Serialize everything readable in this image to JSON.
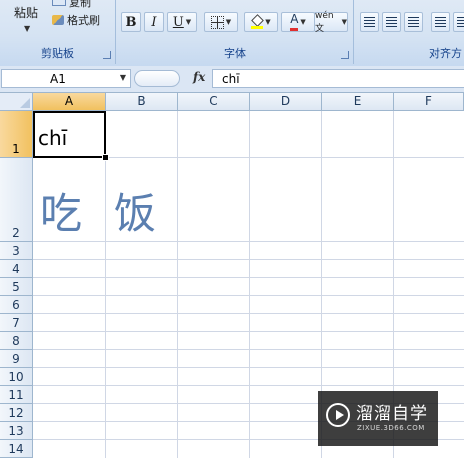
{
  "ribbon": {
    "clipboard": {
      "paste_label": "粘贴",
      "copy_label": "复制",
      "format_painter_label": "格式刷",
      "group_label": "剪贴板"
    },
    "font": {
      "bold": "B",
      "italic": "I",
      "underline": "U",
      "fill_color": "#ffff00",
      "font_color": "#e03030",
      "phonetic_label": "wén 文",
      "group_label": "字体"
    },
    "alignment": {
      "group_label": "对齐方"
    }
  },
  "formula_bar": {
    "name_box": "A1",
    "fx_label": "fx",
    "content": "chī"
  },
  "columns": [
    "A",
    "B",
    "C",
    "D",
    "E",
    "F"
  ],
  "rows": [
    "1",
    "2",
    "3",
    "4",
    "5",
    "6",
    "7",
    "8",
    "9",
    "10",
    "11",
    "12",
    "13",
    "14"
  ],
  "cells": {
    "A1": "chī",
    "A2": "吃",
    "B2": "饭"
  },
  "watermark": {
    "title": "溜溜自学",
    "subtitle": "ZIXUE.3D66.COM"
  }
}
